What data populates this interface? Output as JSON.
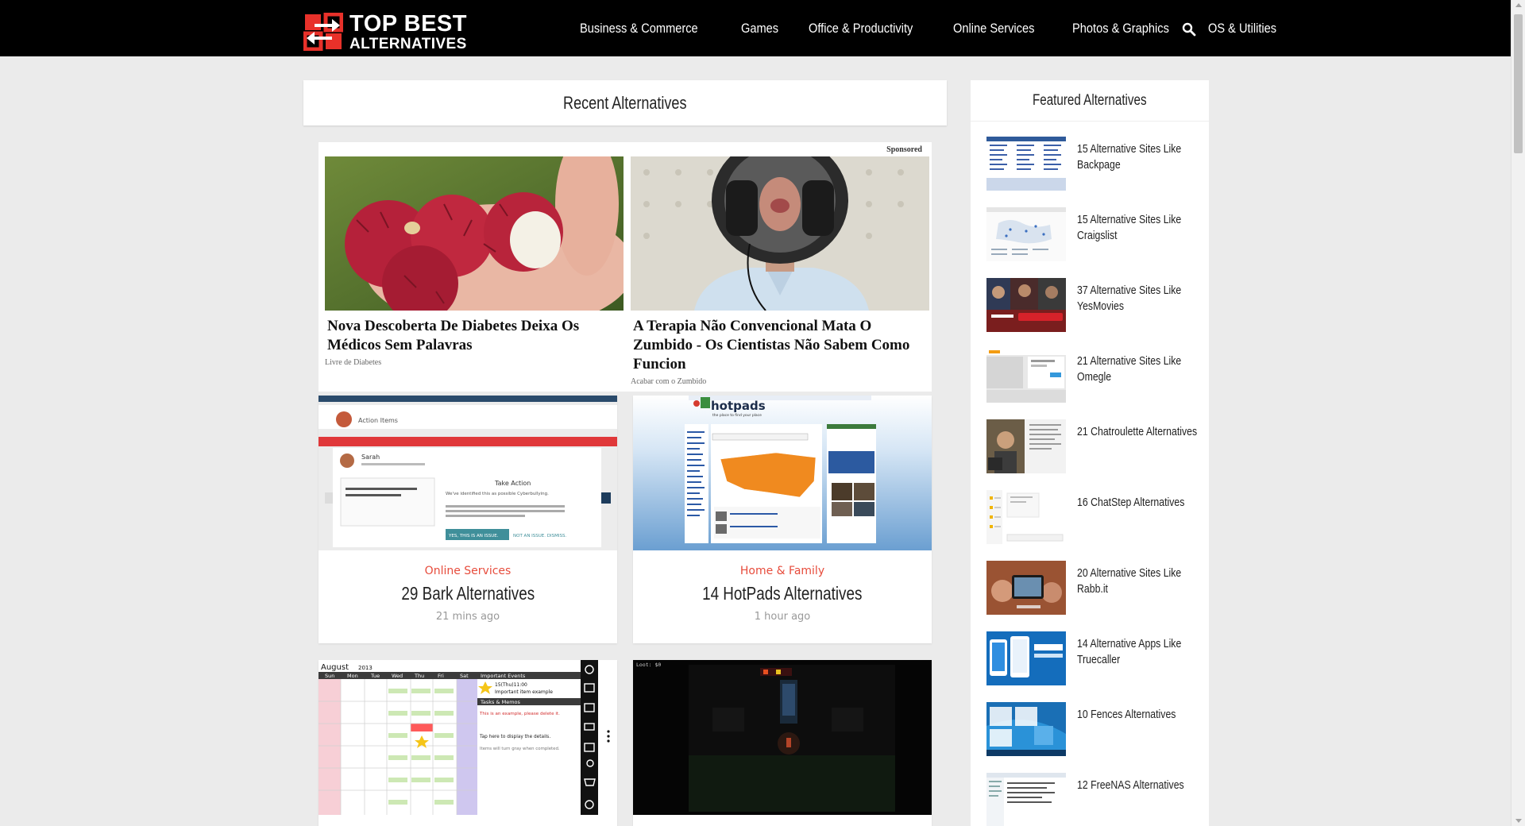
{
  "brand": {
    "line1": "TOP BEST",
    "line2": "ALTERNATIVES",
    "color_red": "#e8312a"
  },
  "nav": {
    "items": [
      "Business & Commerce",
      "Games",
      "Office & Productivity",
      "Online Services",
      "Photos & Graphics",
      "OS & Utilities"
    ],
    "search_icon": "search-icon"
  },
  "main": {
    "title": "Recent Alternatives",
    "sponsored_label": "Sponsored",
    "ads": [
      {
        "title": "Nova Descoberta De Diabetes Deixa Os Médicos Sem Palavras",
        "source": "Livre de Diabetes"
      },
      {
        "title": "A Terapia Não Convencional Mata O Zumbido - Os Cientistas Não Sabem Como Funcion",
        "source": "Acabar com o Zumbido"
      }
    ],
    "cards": [
      {
        "category": "Online Services",
        "title": "29 Bark Alternatives",
        "time": "21 mins ago"
      },
      {
        "category": "Home & Family",
        "title": "14 HotPads Alternatives",
        "time": "1 hour ago"
      },
      {
        "category": "",
        "title": "",
        "time": ""
      },
      {
        "category": "",
        "title": "",
        "time": ""
      }
    ],
    "thumb_text": {
      "bark_action_items": "Action Items",
      "bark_user": "Sarah",
      "bark_take_action": "Take Action",
      "bark_identified": "We've identified this as possible Cyberbullying.",
      "bark_yes": "YES, THIS IS AN ISSUE.",
      "bark_not": "NOT AN ISSUE. DISMISS.",
      "hotpads_logo": "hotpads",
      "hotpads_tagline": "the place to find your place",
      "cal_month": "August",
      "cal_year": "2013",
      "cal_days": [
        "Sun",
        "Mon",
        "Tue",
        "Wed",
        "Thu",
        "Fri",
        "Sat"
      ],
      "cal_events_head": "Important Events",
      "cal_event1": "15(Thu)11:00",
      "cal_event1b": "Important item example",
      "cal_tasks_head": "Tasks & Memos",
      "cal_task1": "This is an example, please delete it.",
      "cal_task2": "Tap here to display the details.",
      "cal_task3": "Items will turn gray when completed.",
      "game_loot": "Loot:  $0"
    }
  },
  "sidebar": {
    "title": "Featured Alternatives",
    "items": [
      "15 Alternative Sites Like Backpage",
      "15 Alternative Sites Like Craigslist",
      "37 Alternative Sites Like YesMovies",
      "21 Alternative Sites Like Omegle",
      "21 Chatroulette Alternatives",
      "16 ChatStep Alternatives",
      "20 Alternative Sites Like Rabb.it",
      "14 Alternative Apps Like Truecaller",
      "10 Fences Alternatives",
      "12 FreeNAS Alternatives"
    ]
  }
}
